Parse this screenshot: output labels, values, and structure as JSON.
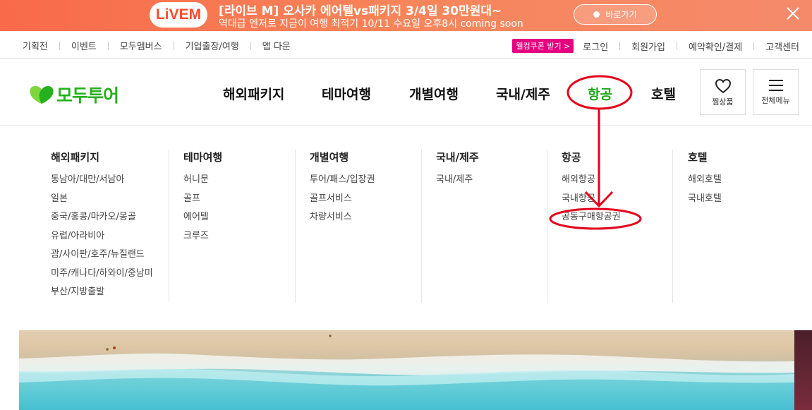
{
  "promo": {
    "badge": "LiVEM",
    "title": "[라이브 M] 오사카 에어텔vs패키지 3/4일 30만원대~",
    "subtitle": "역대급 엔저로 지금이 여행 최적기 10/11 수요일 오후8시 coming soon",
    "cta": "바로가기",
    "close_icon": "close-icon"
  },
  "util": {
    "left": [
      "기획전",
      "이벤트",
      "모두멤버스",
      "기업출장/여행",
      "앱 다운"
    ],
    "coupon": "웰컴쿠폰 받기 >",
    "right": [
      "로그인",
      "회원가입",
      "예약확인/결제",
      "고객센터"
    ]
  },
  "header": {
    "logo": "모두투어",
    "gnb": [
      "해외패키지",
      "테마여행",
      "개별여행",
      "국내/제주",
      "항공",
      "호텔"
    ],
    "active_index": 4,
    "wishlist": "찜상품",
    "menu": "전체메뉴"
  },
  "mega": [
    {
      "head": "해외패키지",
      "links": [
        "동남아/대만/서남아",
        "일본",
        "중국/홍콩/마카오/몽골",
        "유럽/아라비아",
        "괌/사이판/호주/뉴질랜드",
        "미주/캐나다/하와이/중남미",
        "부산/지방출발"
      ]
    },
    {
      "head": "테마여행",
      "links": [
        "허니문",
        "골프",
        "에어텔",
        "크루즈"
      ]
    },
    {
      "head": "개별여행",
      "links": [
        "투어/패스/입장권",
        "골프서비스",
        "차량서비스"
      ]
    },
    {
      "head": "국내/제주",
      "links": [
        "국내/제주"
      ]
    },
    {
      "head": "항공",
      "links": [
        "해외항공",
        "국내항공",
        "공동구매항공권"
      ]
    },
    {
      "head": "호텔",
      "links": [
        "해외호텔",
        "국내호텔"
      ]
    }
  ],
  "colors": {
    "brand": "#25b11d",
    "annotation": "#e3001b",
    "coupon": "#e4007f"
  }
}
